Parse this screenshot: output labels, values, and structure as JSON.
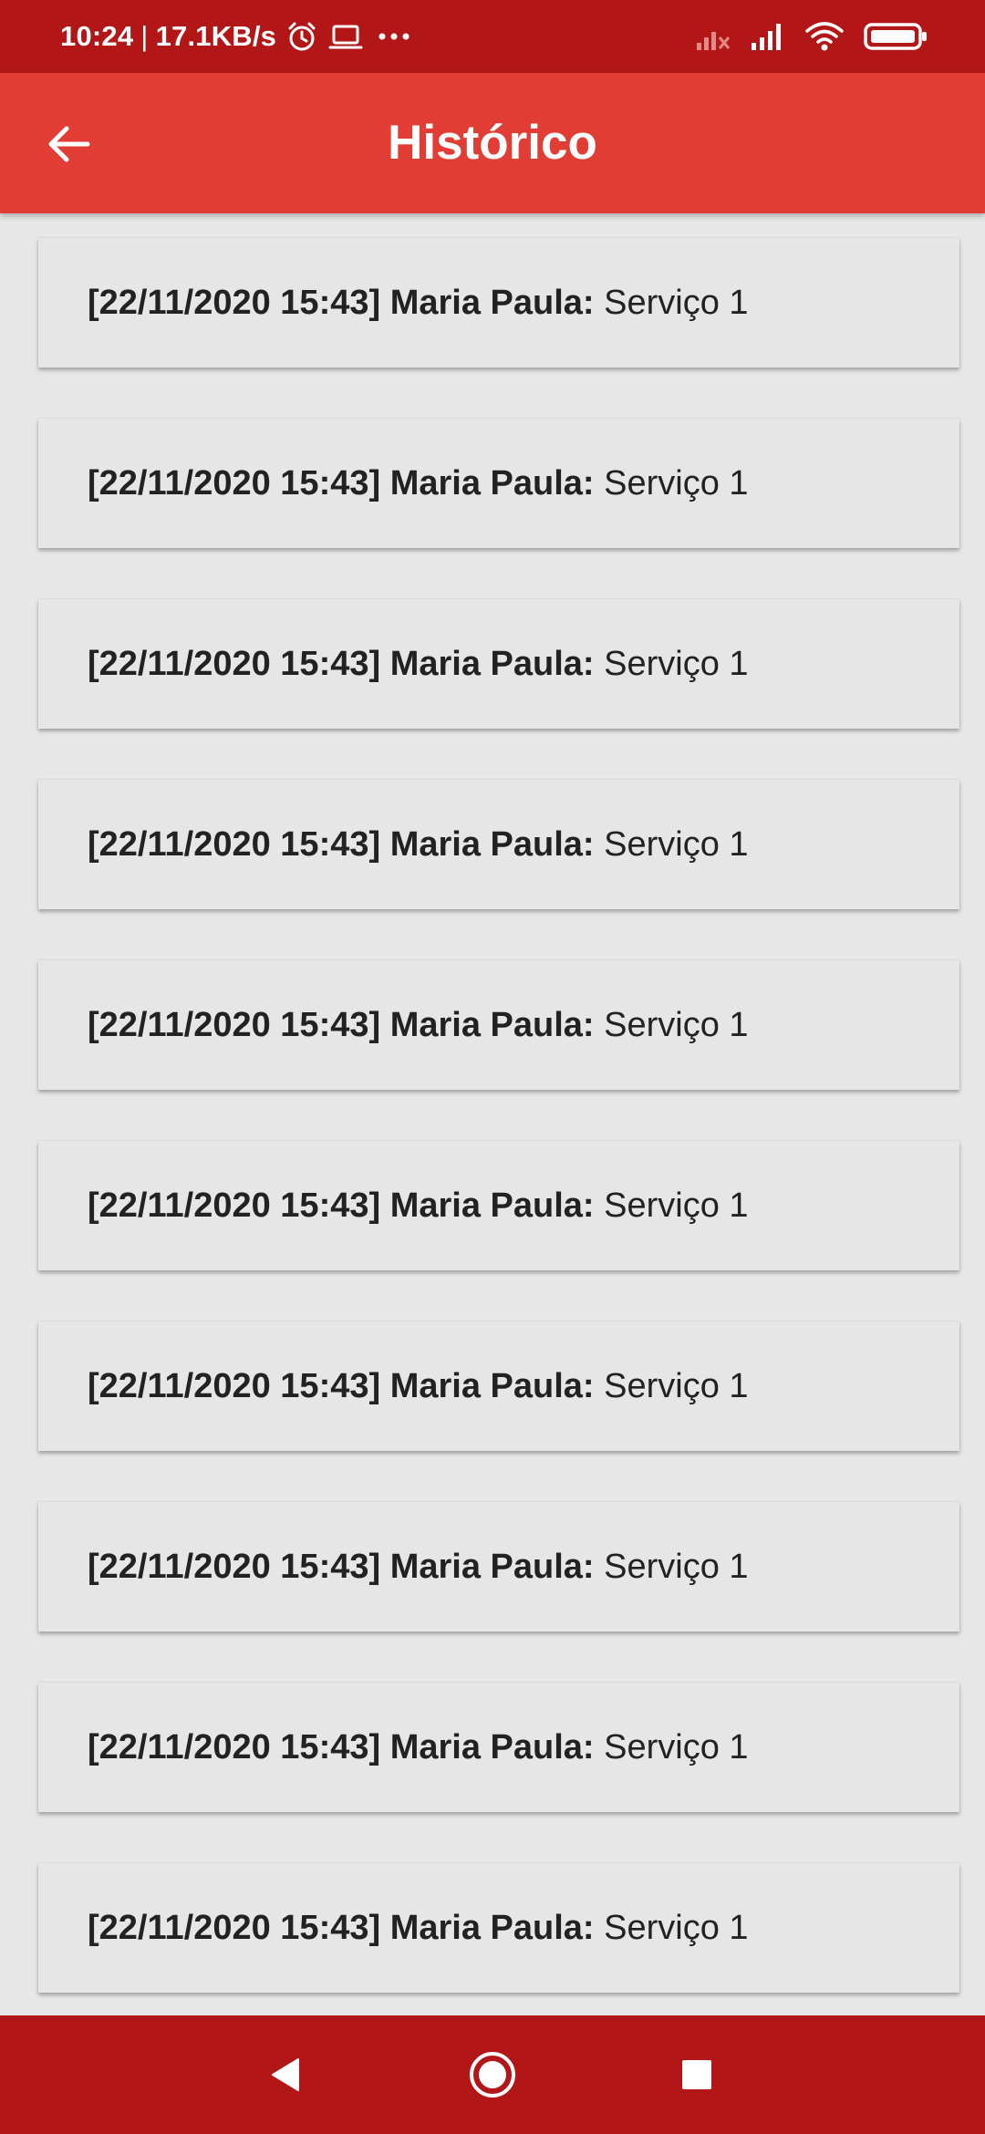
{
  "status_bar": {
    "time": "10:24",
    "speed": "17.1KB/s",
    "icons": [
      "alarm-icon",
      "laptop-icon",
      "more-icon",
      "no-signal-icon",
      "signal-icon",
      "wifi-icon",
      "battery-icon"
    ]
  },
  "app_bar": {
    "title": "Histórico",
    "back_icon": "arrow-left-icon"
  },
  "history": [
    {
      "timestamp": "[22/11/2020 15:43]",
      "user": "Maria Paula:",
      "service": "Serviço 1"
    },
    {
      "timestamp": "[22/11/2020 15:43]",
      "user": "Maria Paula:",
      "service": "Serviço 1"
    },
    {
      "timestamp": "[22/11/2020 15:43]",
      "user": "Maria Paula:",
      "service": "Serviço 1"
    },
    {
      "timestamp": "[22/11/2020 15:43]",
      "user": "Maria Paula:",
      "service": "Serviço 1"
    },
    {
      "timestamp": "[22/11/2020 15:43]",
      "user": "Maria Paula:",
      "service": "Serviço 1"
    },
    {
      "timestamp": "[22/11/2020 15:43]",
      "user": "Maria Paula:",
      "service": "Serviço 1"
    },
    {
      "timestamp": "[22/11/2020 15:43]",
      "user": "Maria Paula:",
      "service": "Serviço 1"
    },
    {
      "timestamp": "[22/11/2020 15:43]",
      "user": "Maria Paula:",
      "service": "Serviço 1"
    },
    {
      "timestamp": "[22/11/2020 15:43]",
      "user": "Maria Paula:",
      "service": "Serviço 1"
    },
    {
      "timestamp": "[22/11/2020 15:43]",
      "user": "Maria Paula:",
      "service": "Serviço 1"
    }
  ],
  "nav_bar": {
    "icons": [
      "back-triangle-icon",
      "home-circle-icon",
      "recents-square-icon"
    ]
  },
  "colors": {
    "status_bar": "#b31616",
    "app_bar": "#e23d35",
    "background": "#e7e7e7",
    "card": "#e6e6e6",
    "text": "#222222"
  }
}
